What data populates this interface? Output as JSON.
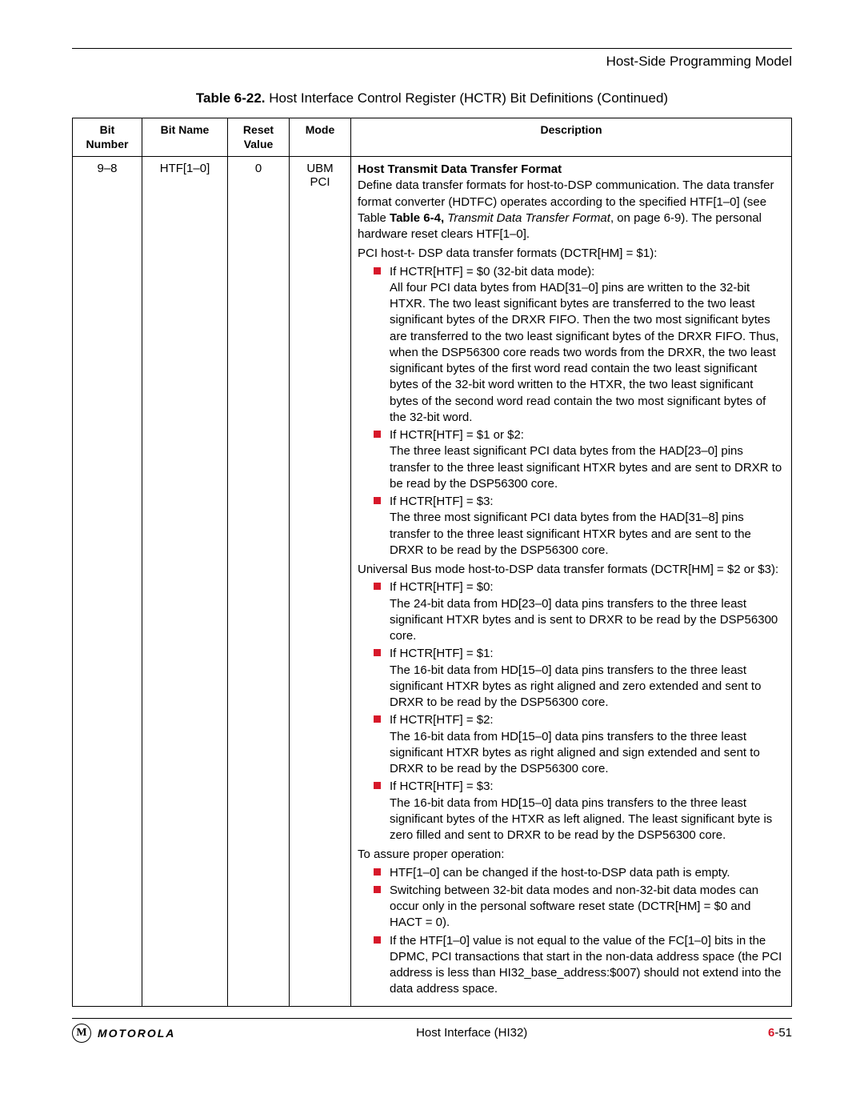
{
  "header": {
    "section": "Host-Side Programming Model"
  },
  "tableTitle": {
    "label": "Table 6-22.",
    "rest": " Host Interface Control Register (HCTR) Bit Definitions (Continued)"
  },
  "columns": {
    "bit": "Bit Number",
    "name": "Bit Name",
    "reset": "Reset Value",
    "mode": "Mode",
    "desc": "Description"
  },
  "row": {
    "bit": "9–8",
    "name": "HTF[1–0]",
    "reset": "0",
    "mode1": "UBM",
    "mode2": "PCI",
    "desc": {
      "heading": "Host Transmit Data Transfer Format",
      "para1a": "Define data transfer formats for host-to-DSP communication. The data transfer format converter (HDTFC) operates according to the specified HTF[1–0] (see Table ",
      "para1b_bold": "Table 6-4,",
      "para1c_italic": " Transmit Data Transfer Format",
      "para1d": ", on page 6-9). The personal hardware reset clears HTF[1–0].",
      "pciLine": "PCI host-t- DSP data transfer formats (DCTR[HM] = $1):",
      "pciList": [
        {
          "head": "If HCTR[HTF] = $0 (32-bit data mode):",
          "body": "All four PCI data bytes from HAD[31–0] pins are written to the 32-bit HTXR. The two least significant bytes are transferred to the two least significant bytes of the DRXR FIFO. Then the two most significant bytes are transferred to the two least significant bytes of the DRXR FIFO. Thus, when the DSP56300 core reads two words from the DRXR, the two least significant bytes of the first word read contain the two least significant bytes of the 32-bit word written to the HTXR, the two least significant bytes of the second word read contain the two most significant bytes of the 32-bit word."
        },
        {
          "head": "If HCTR[HTF] = $1 or $2:",
          "body": "The three least significant PCI data bytes from the HAD[23–0] pins transfer to the three least significant HTXR bytes and are sent to DRXR to be read by the DSP56300 core."
        },
        {
          "head": "If HCTR[HTF] = $3:",
          "body": "The three most significant PCI data bytes from the HAD[31–8] pins transfer to the three least significant HTXR bytes and are sent to the DRXR to be read by the DSP56300 core."
        }
      ],
      "ubmLine": "Universal Bus mode host-to-DSP data transfer formats (DCTR[HM] = $2 or $3):",
      "ubmList": [
        {
          "head": "If HCTR[HTF] = $0:",
          "body": "The 24-bit data from HD[23–0] data pins transfers to the three least significant HTXR bytes and is sent to DRXR to be read by the DSP56300 core."
        },
        {
          "head": "If HCTR[HTF] = $1:",
          "body": "The 16-bit data from HD[15–0] data pins transfers to the three least significant HTXR bytes as right aligned and zero extended and sent to DRXR to be read by the DSP56300 core."
        },
        {
          "head": "If HCTR[HTF] = $2:",
          "body": "The 16-bit data from HD[15–0] data pins transfers to the three least significant HTXR bytes as right aligned and sign extended and sent to DRXR to be read by the DSP56300 core."
        },
        {
          "head": "If HCTR[HTF] = $3:",
          "body": "The 16-bit data from HD[15–0] data pins transfers to the three least significant bytes of the HTXR as left aligned. The least significant byte is zero filled and sent to DRXR to be read by the DSP56300 core."
        }
      ],
      "assureLine": "To assure proper operation:",
      "assureList": [
        {
          "body": "HTF[1–0] can be changed if the host-to-DSP data path is empty."
        },
        {
          "body": "Switching between 32-bit data modes and non-32-bit data modes can occur only in the personal software reset state (DCTR[HM]  =  $0 and HACT = 0)."
        },
        {
          "body": "If the HTF[1–0] value is not equal to the value of the FC[1–0] bits in the DPMC, PCI transactions that start in the non-data address space (the PCI address is less than HI32_base_address:$007) should not extend into the data address space."
        }
      ]
    }
  },
  "footer": {
    "logoLetter": "M",
    "brand": "MOTOROLA",
    "center": "Host Interface (HI32)",
    "pageChap": "6",
    "pageSep": "-",
    "pageNum": "51"
  }
}
